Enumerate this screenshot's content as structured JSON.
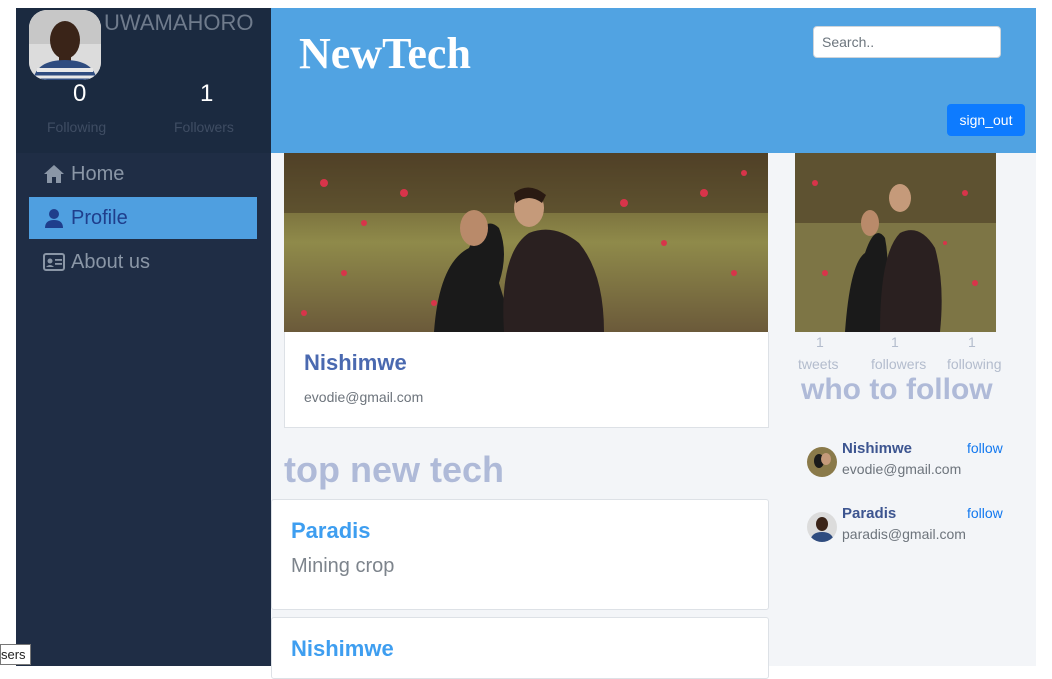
{
  "sidebar": {
    "username": "UWAMAHORO",
    "following_count": "0",
    "following_label": "Following",
    "followers_count": "1",
    "followers_label": "Followers",
    "items": [
      {
        "label": "Home",
        "icon": "home-icon",
        "active": false
      },
      {
        "label": "Profile",
        "icon": "user-icon",
        "active": true
      },
      {
        "label": "About us",
        "icon": "id-card-icon",
        "active": false
      }
    ]
  },
  "header": {
    "brand": "NewTech",
    "search_placeholder": "Search..",
    "signout_label": "sign_out"
  },
  "profile": {
    "name": "Nishimwe",
    "email": "evodie@gmail.com"
  },
  "section_title": "top new tech",
  "posts": [
    {
      "author": "Paradis",
      "text": "Mining crop"
    },
    {
      "author": "Nishimwe",
      "text": ""
    }
  ],
  "right": {
    "tweets_count": "1",
    "tweets_label": "tweets",
    "followers_count": "1",
    "followers_label": "followers",
    "following_count": "1",
    "following_label": "following",
    "who_to_follow": "who to follow",
    "suggestions": [
      {
        "name": "Nishimwe",
        "email": "evodie@gmail.com",
        "action": "follow"
      },
      {
        "name": "Paradis",
        "email": "paradis@gmail.com",
        "action": "follow"
      }
    ]
  },
  "tooltip": "sers",
  "colors": {
    "sidebar_bg": "#1f2d45",
    "header_bg": "#51a3e2",
    "active_nav": "#4f9fe0",
    "button_primary": "#0d7bff",
    "link_blue": "#1278ef"
  }
}
